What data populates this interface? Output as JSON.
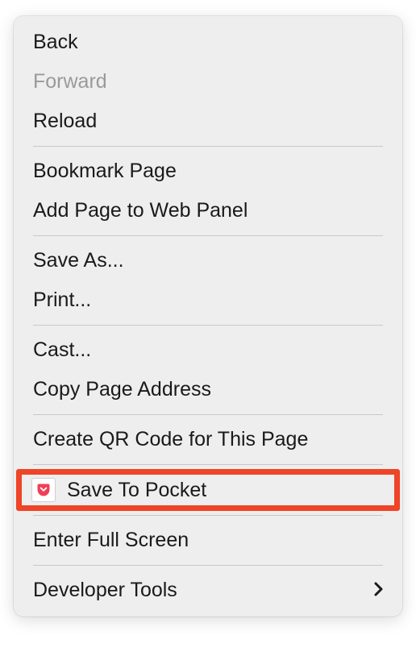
{
  "menu": {
    "groups": [
      [
        {
          "id": "back",
          "label": "Back",
          "enabled": true
        },
        {
          "id": "forward",
          "label": "Forward",
          "enabled": false
        },
        {
          "id": "reload",
          "label": "Reload",
          "enabled": true
        }
      ],
      [
        {
          "id": "bookmark-page",
          "label": "Bookmark Page",
          "enabled": true
        },
        {
          "id": "add-to-web-panel",
          "label": "Add Page to Web Panel",
          "enabled": true
        }
      ],
      [
        {
          "id": "save-as",
          "label": "Save As...",
          "enabled": true
        },
        {
          "id": "print",
          "label": "Print...",
          "enabled": true
        }
      ],
      [
        {
          "id": "cast",
          "label": "Cast...",
          "enabled": true
        },
        {
          "id": "copy-address",
          "label": "Copy Page Address",
          "enabled": true
        }
      ],
      [
        {
          "id": "create-qr",
          "label": "Create QR Code for This Page",
          "enabled": true
        }
      ],
      [
        {
          "id": "save-to-pocket",
          "label": "Save To Pocket",
          "enabled": true,
          "icon": "pocket-icon",
          "highlighted": true
        }
      ],
      [
        {
          "id": "enter-full-screen",
          "label": "Enter Full Screen",
          "enabled": true
        }
      ],
      [
        {
          "id": "developer-tools",
          "label": "Developer Tools",
          "enabled": true,
          "submenu": true
        }
      ]
    ]
  },
  "colors": {
    "highlight": "#ef4427",
    "pocket": "#ee4056"
  }
}
